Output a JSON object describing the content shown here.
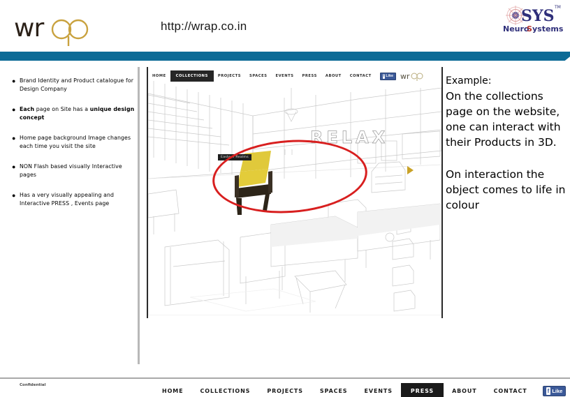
{
  "header": {
    "brand_logo_text": "wrap",
    "url": "http://wrap.co.in",
    "company_logo_text": "iOSYS",
    "company_logo_sub": "NeuroSystems",
    "company_logo_tm": "TM",
    "accent_bar_color": "#0c6b96"
  },
  "bullets": [
    {
      "segments": [
        {
          "text": "Brand Identity and Product catalogue for Design Company",
          "bold": false
        }
      ]
    },
    {
      "segments": [
        {
          "text": "Each",
          "bold": true
        },
        {
          "text": " page on Site has a ",
          "bold": false
        },
        {
          "text": "unique design concept",
          "bold": true
        }
      ]
    },
    {
      "segments": [
        {
          "text": "Home page background Image changes each time you visit the site",
          "bold": false
        }
      ]
    },
    {
      "segments": [
        {
          "text": "NON Flash based visually Interactive pages",
          "bold": false
        }
      ]
    },
    {
      "segments": [
        {
          "text": "Has a very visually appealing and Interactive PRESS , Events page",
          "bold": false
        }
      ]
    }
  ],
  "commentary": {
    "lead": "Example:",
    "paragraph_one": "On the collections page on the website, one can interact with their Products in 3D.",
    "paragraph_two": "On interaction the object comes to life in colour"
  },
  "site_shot": {
    "nav": [
      {
        "label": "HOME",
        "active": false
      },
      {
        "label": "COLLECTIONS",
        "active": true
      },
      {
        "label": "PROJECTS",
        "active": false
      },
      {
        "label": "SPACES",
        "active": false
      },
      {
        "label": "EVENTS",
        "active": false
      },
      {
        "label": "PRESS",
        "active": false
      },
      {
        "label": "ABOUT",
        "active": false
      },
      {
        "label": "CONTACT",
        "active": false
      }
    ],
    "facebook_like_label": "Like",
    "facebook_f": "f",
    "logo_text": "wrap",
    "scene_word": "RELAX",
    "product_tooltip": "Eastern Realms",
    "highlight_color": "#d81f1f",
    "play_arrow_color": "#c9a227"
  },
  "footer": {
    "confidential": "Confidential",
    "nav": [
      {
        "label": "HOME",
        "active": false
      },
      {
        "label": "COLLECTIONS",
        "active": false
      },
      {
        "label": "PROJECTS",
        "active": false
      },
      {
        "label": "SPACES",
        "active": false
      },
      {
        "label": "EVENTS",
        "active": false
      },
      {
        "label": "PRESS",
        "active": true
      },
      {
        "label": "ABOUT",
        "active": false
      },
      {
        "label": "CONTACT",
        "active": false
      }
    ],
    "facebook_like_label": "Like",
    "facebook_f": "f"
  }
}
